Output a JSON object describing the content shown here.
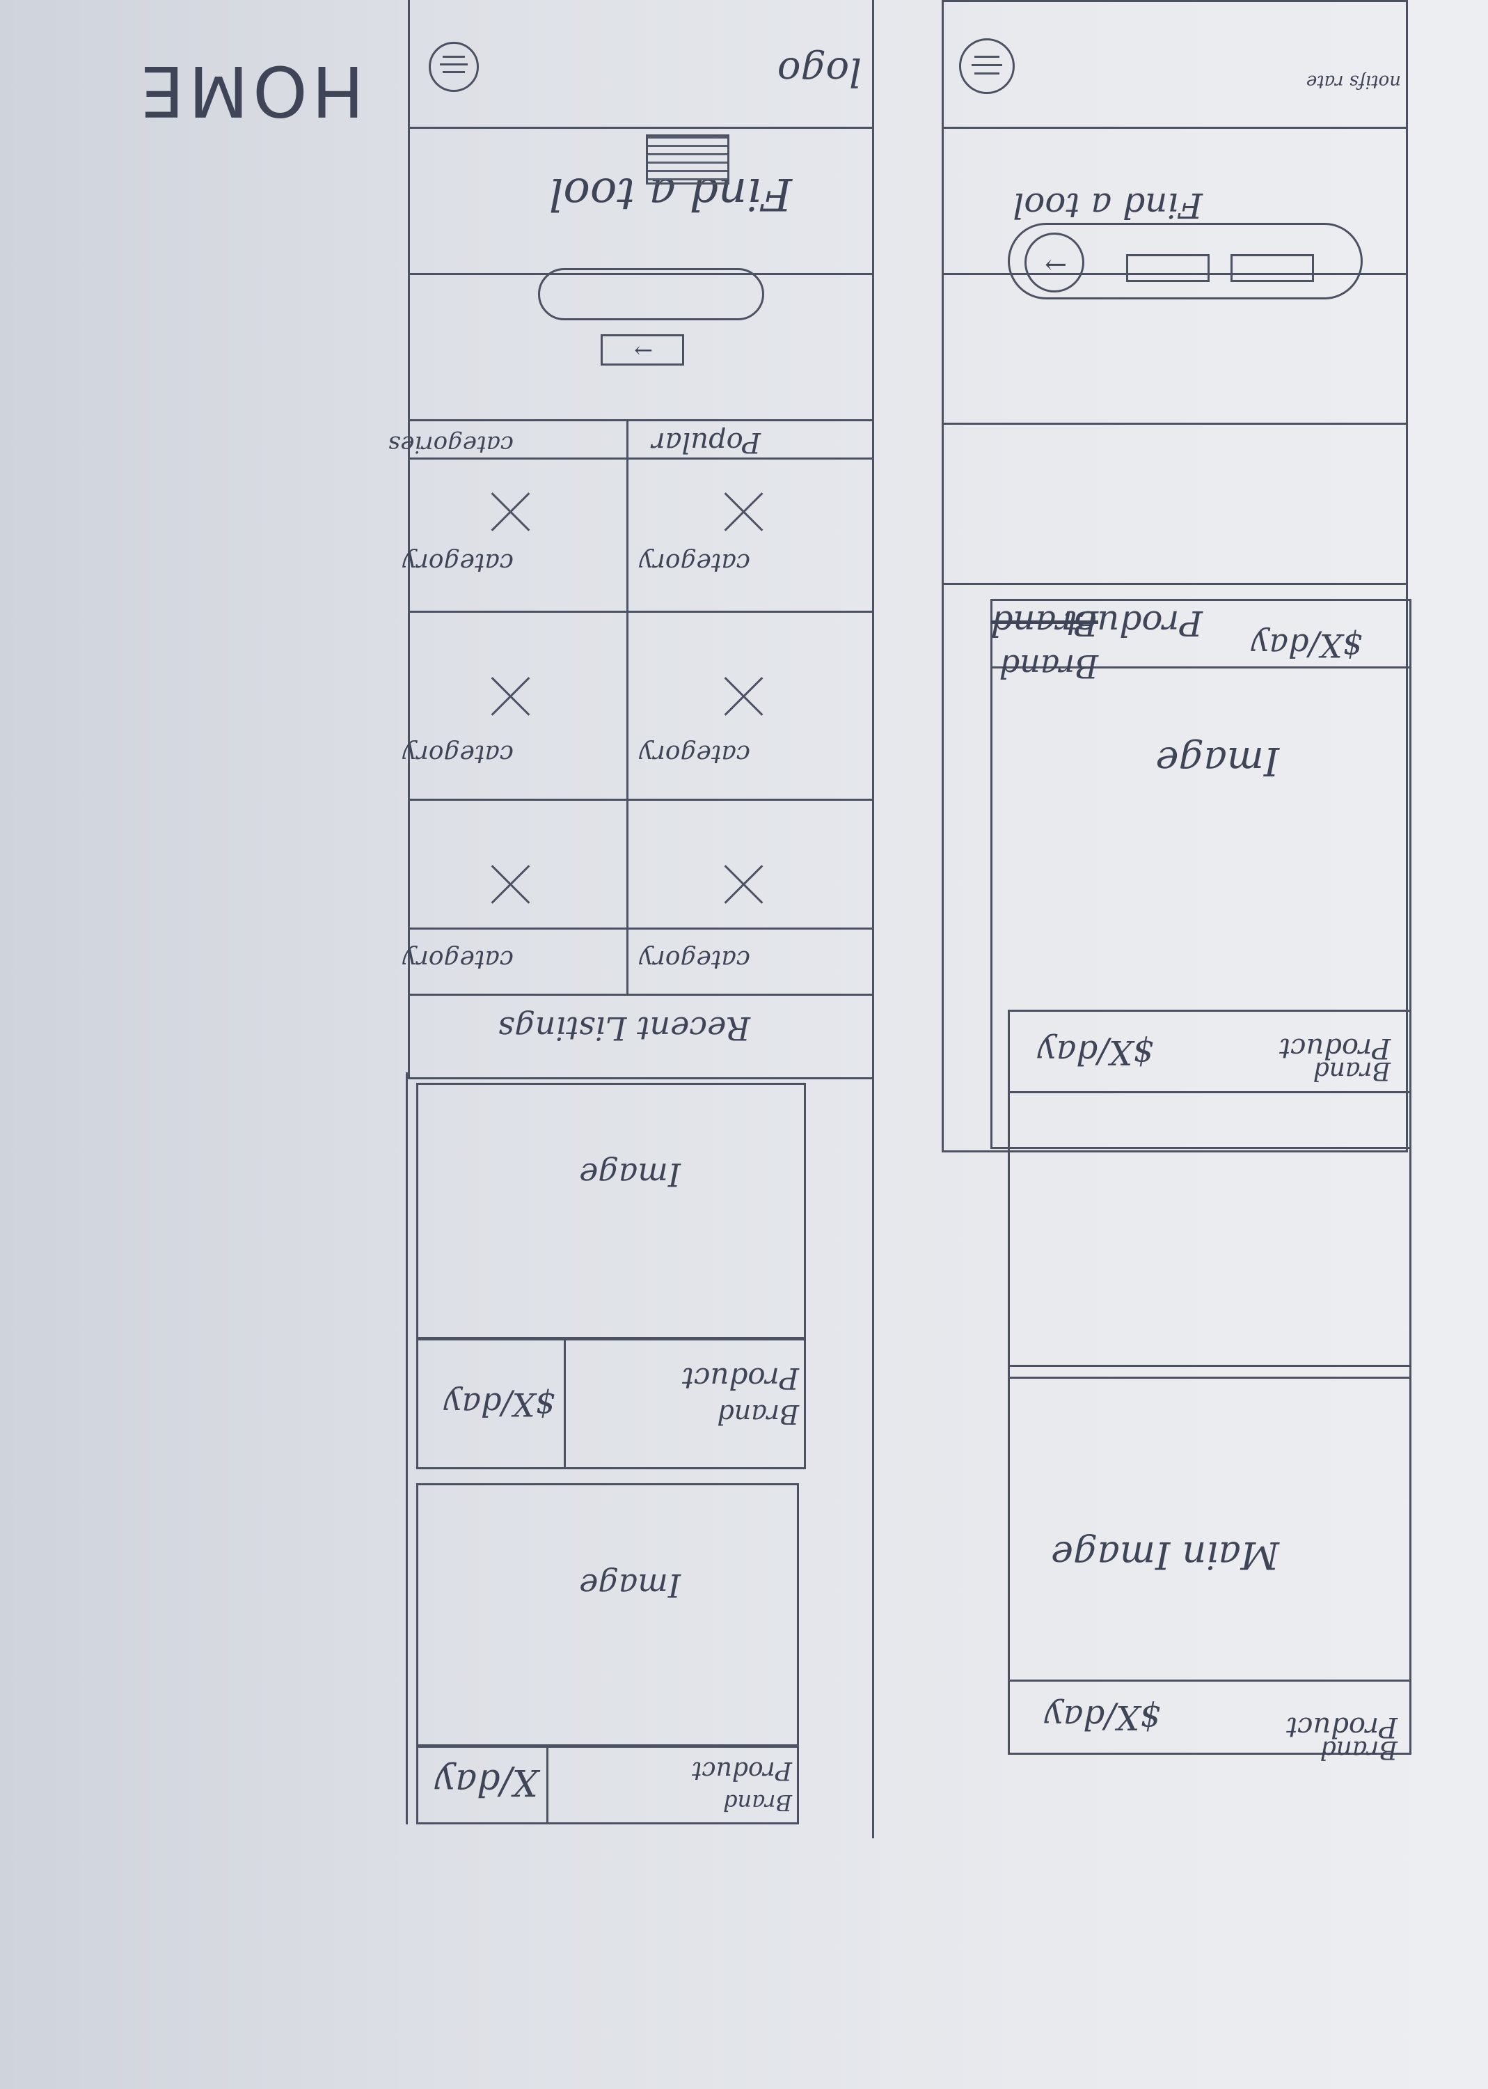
{
  "page_label": "HOME",
  "header": {
    "logo": "logo"
  },
  "search": {
    "title_left": "Find a tool",
    "title_right": "Find a tool"
  },
  "popular": {
    "heading_left": "Popular",
    "heading_right": "categories",
    "item_label": "category"
  },
  "recent": {
    "heading": "Recent Listings"
  },
  "listing": {
    "image": "Image",
    "main_image": "Main Image",
    "product": "Product",
    "brand": "Brand",
    "price": "$X/day",
    "price_alt": "X/day",
    "brand_product_struck": "Brand",
    "brand_product": "Product"
  },
  "notes": {
    "text": "notifs rate"
  }
}
